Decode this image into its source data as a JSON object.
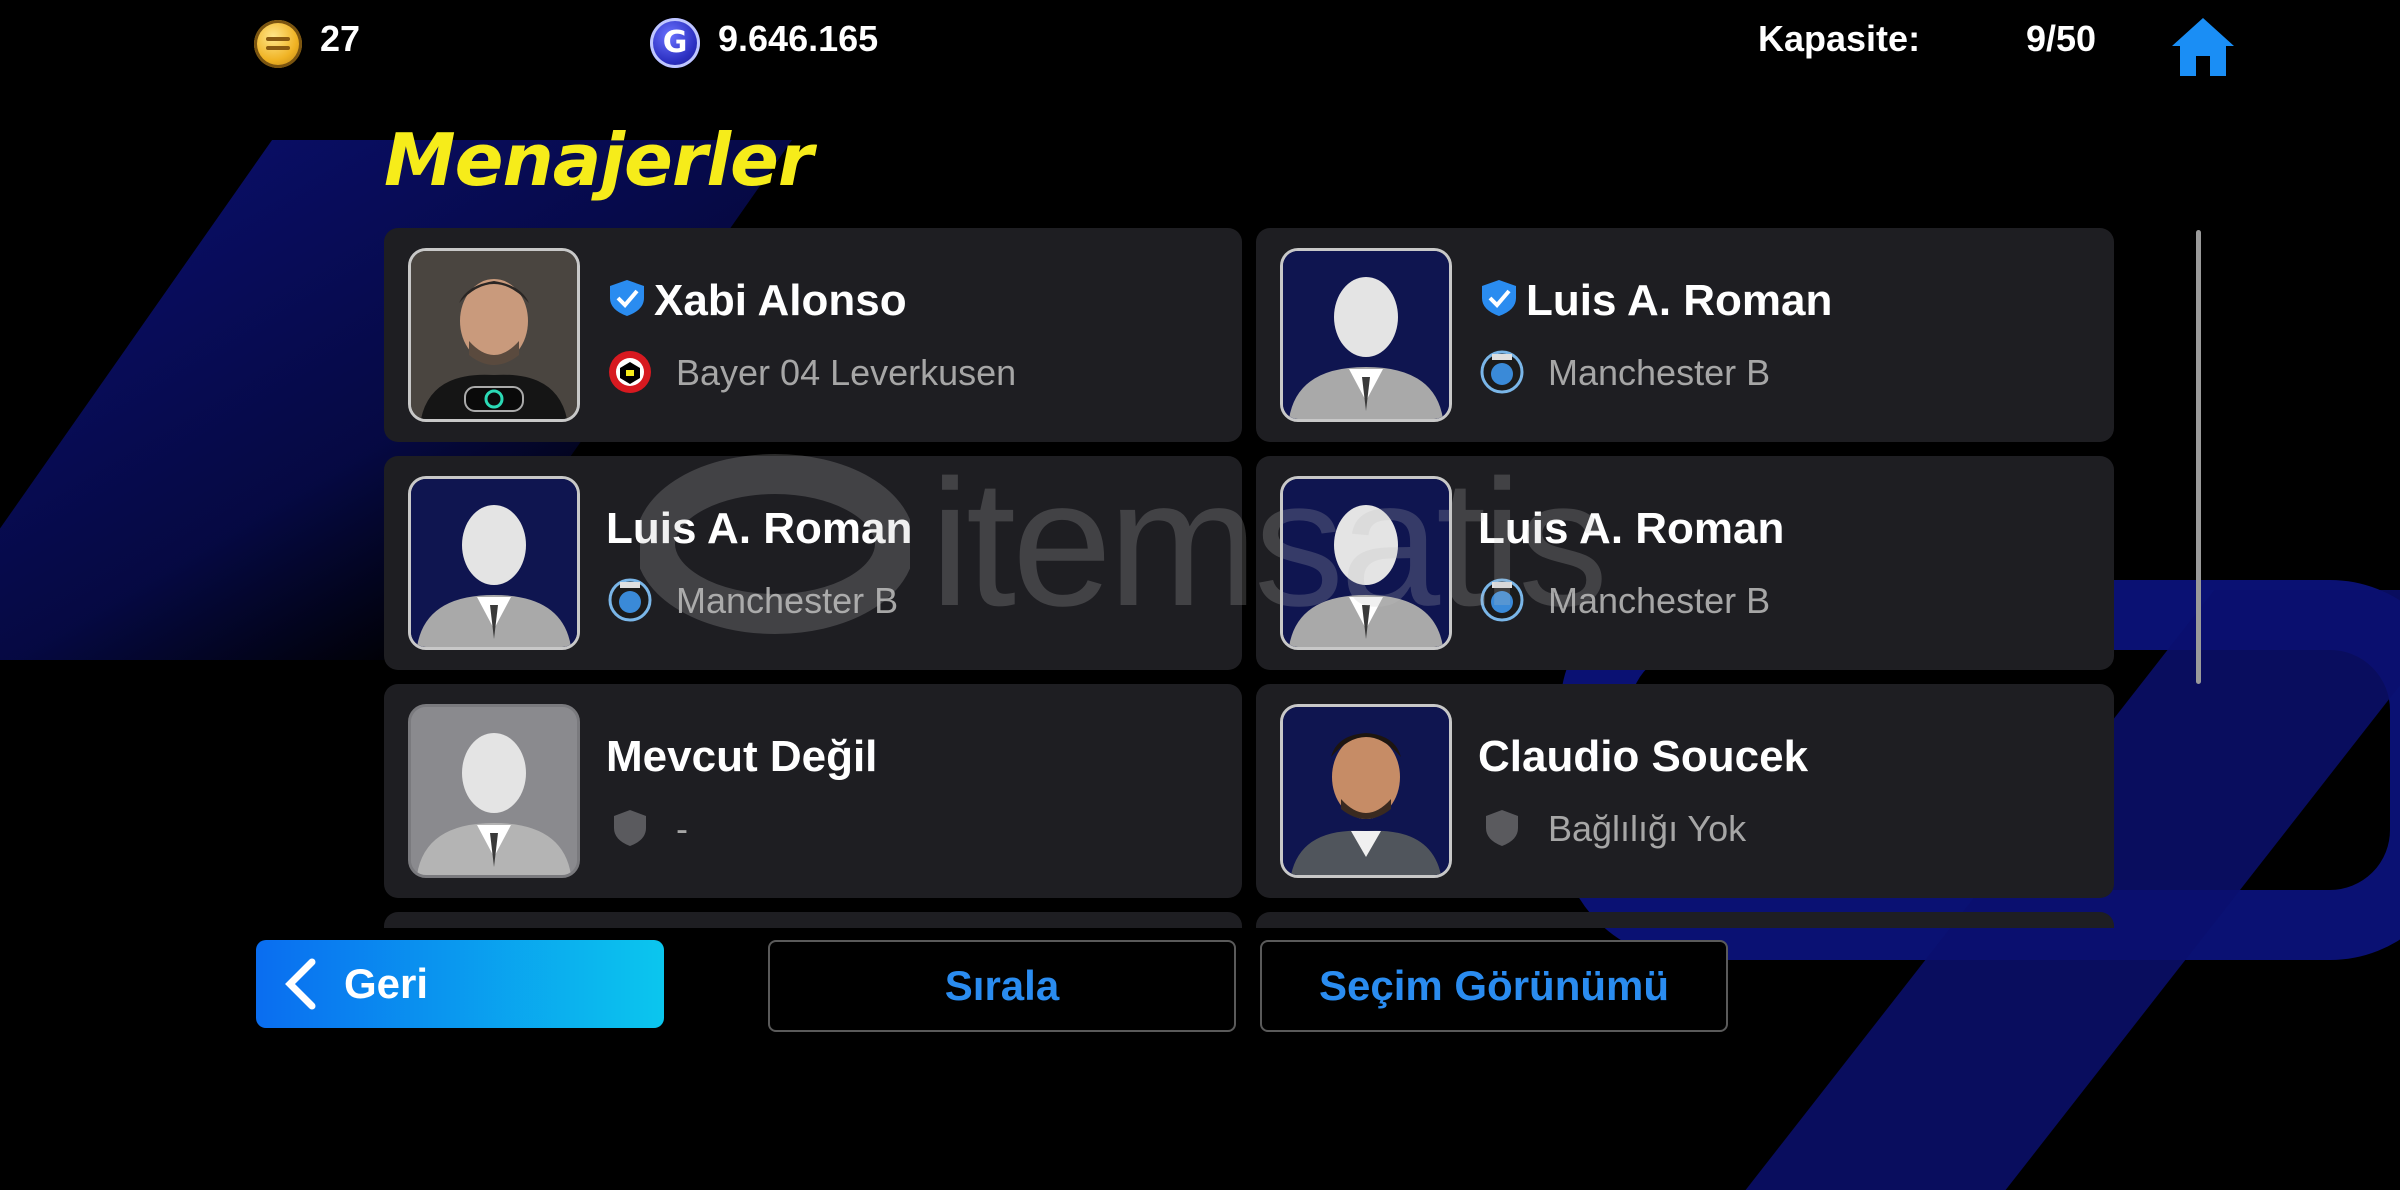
{
  "header": {
    "coins": "27",
    "gp": "9.646.165",
    "gp_icon_letter": "G",
    "capacity_label": "Kapasite:",
    "capacity_value": "9/50"
  },
  "page_title": "Menajerler",
  "managers": [
    {
      "name": "Xabi Alonso",
      "team": "Bayer 04 Leverkusen",
      "verified": true,
      "portrait": "real-photo",
      "team_icon": "leverkusen-crest-icon"
    },
    {
      "name": "Luis A. Roman",
      "team": "Manchester B",
      "verified": true,
      "portrait": "silhouette",
      "team_icon": "club-crest-icon"
    },
    {
      "name": "Luis A. Roman",
      "team": "Manchester B",
      "verified": false,
      "portrait": "silhouette",
      "team_icon": "club-crest-icon"
    },
    {
      "name": "Luis A. Roman",
      "team": "Manchester B",
      "verified": false,
      "portrait": "silhouette",
      "team_icon": "club-crest-icon"
    },
    {
      "name": "Mevcut Değil",
      "team": "-",
      "verified": false,
      "portrait": "silhouette-gray",
      "team_icon": "shield-icon"
    },
    {
      "name": "Claudio Soucek",
      "team": "Bağlılığı Yok",
      "verified": false,
      "portrait": "real-photo",
      "team_icon": "shield-icon"
    }
  ],
  "buttons": {
    "back": "Geri",
    "sort": "Sırala",
    "selection_view": "Seçim Görünümü"
  },
  "watermark": "itemsatis",
  "colors": {
    "title": "#f6ec1a",
    "accent_blue": "#2a8cf0",
    "card_bg": "#1e1e22"
  }
}
